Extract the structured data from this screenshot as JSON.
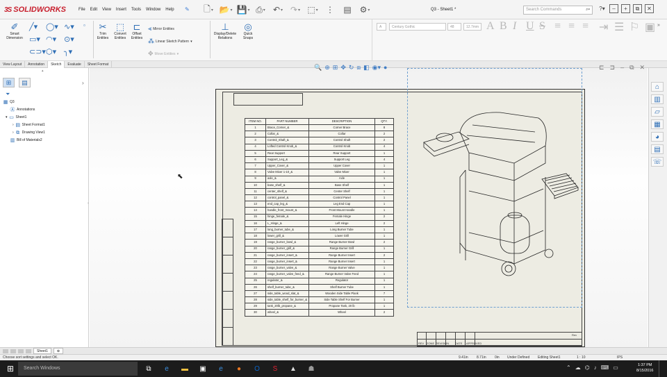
{
  "app": {
    "logo_text": "SOLIDWORKS",
    "menu": [
      "File",
      "Edit",
      "View",
      "Insert",
      "Tools",
      "Window",
      "Help"
    ],
    "document_title": "Q3 - Sheet1 *",
    "search_placeholder": "Search Commands"
  },
  "ribbon": {
    "smart_dimension": "Smart Dimension",
    "trim_entities": "Trim Entities",
    "convert_entities": "Convert Entities",
    "offset_entities": "Offset Entities",
    "mirror_entities": "Mirror Entities",
    "linear_sketch_pattern": "Linear Sketch Pattern",
    "move_entities": "Move Entities",
    "display_delete_relations": "Display/Delete Relations",
    "quick_snaps": "Quick Snaps"
  },
  "format_bar": {
    "font": "Century Gothic",
    "size": "48",
    "height": "12.7mm"
  },
  "tabs": [
    "View Layout",
    "Annotation",
    "Sketch",
    "Evaluate",
    "Sheet Format"
  ],
  "active_tab": "Sketch",
  "tree": [
    {
      "label": "Q3",
      "icon": "drawing-icon",
      "indent": 0
    },
    {
      "label": "Annotations",
      "icon": "annotation-icon",
      "indent": 1
    },
    {
      "label": "Sheet1",
      "icon": "sheet-icon",
      "indent": 1
    },
    {
      "label": "Sheet Format1",
      "icon": "sheet-format-icon",
      "indent": 2
    },
    {
      "label": "Drawing View1",
      "icon": "drawing-view-icon",
      "indent": 2
    },
    {
      "label": "Bill of Materials2",
      "icon": "bom-icon",
      "indent": 1
    }
  ],
  "bom": {
    "headers": [
      "ITEM NO.",
      "PART NUMBER",
      "DESCRIPTION",
      "QTY."
    ],
    "rows": [
      [
        "1",
        "Brace_Corner_&",
        "Corner Brace",
        "8"
      ],
      [
        "2",
        "Collar_&",
        "Collar",
        "2"
      ],
      [
        "3",
        "Control_Shaft_&",
        "Control Shaft",
        "2"
      ],
      [
        "4",
        "Lofted Control Knob_&",
        "Control Knob",
        "4"
      ],
      [
        "5",
        "Rear Support",
        "Rear Support",
        "1"
      ],
      [
        "6",
        "Support_Leg_&",
        "Support Leg",
        "4"
      ],
      [
        "7",
        "Upper_Cover_&",
        "Upper Cover",
        "1"
      ],
      [
        "8",
        "Valve Mixer 1-10_&",
        "Valve Mixer",
        "1"
      ],
      [
        "9",
        "axle_&",
        "Axle",
        "1"
      ],
      [
        "10",
        "base_shelf_&",
        "Base Shelf",
        "1"
      ],
      [
        "11",
        "center_shelf_&",
        "Center Shelf",
        "1"
      ],
      [
        "12",
        "control_panel_&",
        "Control Panel",
        "1"
      ],
      [
        "13",
        "end_cap_leg_&",
        "Leg End Cap",
        "1"
      ],
      [
        "14",
        "handle_front_mount_&",
        "Front Mount Handle",
        "1"
      ],
      [
        "15",
        "hinge_female_&",
        "Female Hinge",
        "2"
      ],
      [
        "16",
        "L_Hinge_&",
        "Left Hinge",
        "2"
      ],
      [
        "17",
        "long_burner_tube_&",
        "Long Burner Tube",
        "1"
      ],
      [
        "18",
        "lower_grill_&",
        "Lower Grill",
        "1"
      ],
      [
        "19",
        "range_burner_bowl_&",
        "Range Burner Bowl",
        "2"
      ],
      [
        "20",
        "range_burner_grill_&",
        "Range Burner Grill",
        "1"
      ],
      [
        "21",
        "range_burner_insert_&",
        "Range Burner Insert",
        "2"
      ],
      [
        "22",
        "range_burner_insert_&",
        "Range Burner Insert",
        "1"
      ],
      [
        "23",
        "range_burner_valve_&",
        "Range Burner Valve",
        "1"
      ],
      [
        "24",
        "range_burner_valve_feed_&",
        "Range Burner Valve Feed",
        "1"
      ],
      [
        "25",
        "regulator_&",
        "Regulator",
        "1"
      ],
      [
        "26",
        "shelf_burner_tube_&",
        "Shelf Burner Tube",
        "1"
      ],
      [
        "27",
        "side_table_wood_slat_&",
        "Wooden Side Table Plank",
        "7"
      ],
      [
        "28",
        "side_table_shelf_for_burner_&",
        "Side Table Shelf For Burner",
        "1"
      ],
      [
        "29",
        "tank_20lb_propane_&",
        "Propane Tank, 20 lb",
        "1"
      ],
      [
        "30",
        "wheel_&",
        "Wheel",
        "2"
      ]
    ]
  },
  "title_block": {
    "labels": [
      "REV",
      "ZONE",
      "REVISION",
      "DATE",
      "APPROVED"
    ],
    "scale_label": "Scale 1:1",
    "sheet_label": "Sheet 1 of 1",
    "rev": "Rev"
  },
  "sheet_tabs": [
    "Sheet1"
  ],
  "status": {
    "message": "Choose sort settings and select OK.",
    "x": "9.41in",
    "y": "8.71in",
    "z": "0in",
    "state": "Under Defined",
    "editing": "Editing Sheet1",
    "scale": "1 : 10",
    "units": "IPS"
  },
  "taskbar": {
    "search": "Search Windows",
    "time": "1:37 PM",
    "date": "8/15/2016"
  },
  "colors": {
    "accent": "#2e6eb5",
    "brand": "#c8202e",
    "sheet_bg": "#edece3"
  }
}
